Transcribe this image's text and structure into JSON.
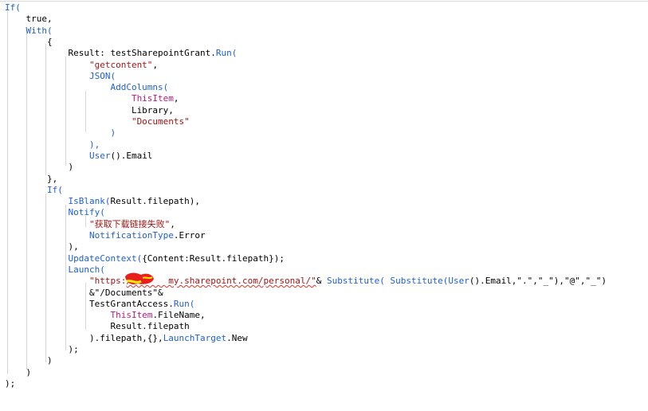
{
  "editor": {
    "lines": [
      [
        {
          "t": "If(",
          "c": "kw"
        }
      ],
      [
        {
          "t": "    true,",
          "c": "pl"
        }
      ],
      [
        {
          "t": "    With(",
          "c": "kw"
        }
      ],
      [
        {
          "t": "        {",
          "c": "pl"
        }
      ],
      [
        {
          "t": "            Result: testSharepointGrant.",
          "c": "pl"
        },
        {
          "t": "Run(",
          "c": "fn"
        }
      ],
      [
        {
          "t": "                \"getcontent\"",
          "c": "str"
        },
        {
          "t": ",",
          "c": "pl"
        }
      ],
      [
        {
          "t": "                JSON(",
          "c": "fn"
        }
      ],
      [
        {
          "t": "                    AddColumns(",
          "c": "fn"
        }
      ],
      [
        {
          "t": "                        ThisItem",
          "c": "id"
        },
        {
          "t": ",",
          "c": "pl"
        }
      ],
      [
        {
          "t": "                        Library,",
          "c": "pl"
        }
      ],
      [
        {
          "t": "                        \"Documents\"",
          "c": "str"
        }
      ],
      [
        {
          "t": "                    )",
          "c": "fn"
        }
      ],
      [
        {
          "t": "                ),",
          "c": "fn"
        }
      ],
      [
        {
          "t": "                User",
          "c": "fn"
        },
        {
          "t": "().Email",
          "c": "pl"
        }
      ],
      [
        {
          "t": "            )",
          "c": "pl"
        }
      ],
      [
        {
          "t": "        },",
          "c": "pl"
        }
      ],
      [
        {
          "t": "        If(",
          "c": "kw"
        }
      ],
      [
        {
          "t": "            IsBlank(",
          "c": "fn"
        },
        {
          "t": "Result.filepath),",
          "c": "pl"
        }
      ],
      [
        {
          "t": "            Notify(",
          "c": "fn"
        }
      ],
      [
        {
          "t": "                \"获取下载链接失败\"",
          "c": "str"
        },
        {
          "t": ",",
          "c": "pl"
        }
      ],
      [
        {
          "t": "                NotificationType",
          "c": "fn"
        },
        {
          "t": ".Error",
          "c": "pl"
        }
      ],
      [
        {
          "t": "            ),",
          "c": "pl"
        }
      ],
      [
        {
          "t": "            UpdateContext(",
          "c": "fn"
        },
        {
          "t": "{Content:Result.filepath});",
          "c": "pl"
        }
      ],
      [
        {
          "t": "            Launch(",
          "c": "fn"
        }
      ],
      [
        {
          "t": "                \"https:",
          "c": "str"
        },
        {
          "t": "//      my.sharepoint.com/personal/\"",
          "c": "str",
          "e": true
        },
        {
          "t": "& ",
          "c": "pl"
        },
        {
          "t": "Substitute( Substitute(",
          "c": "fn"
        },
        {
          "t": "User",
          "c": "fn"
        },
        {
          "t": "().Email,\".\",\"_\"),\"@\",\"_\")",
          "c": "pl"
        }
      ],
      [
        {
          "t": "                &\"/Documents\"&",
          "c": "pl"
        }
      ],
      [
        {
          "t": "                TestGrantAccess.",
          "c": "pl"
        },
        {
          "t": "Run(",
          "c": "fn"
        }
      ],
      [
        {
          "t": "                    ThisItem",
          "c": "id"
        },
        {
          "t": ".FileName,",
          "c": "pl"
        }
      ],
      [
        {
          "t": "                    Result.filepath",
          "c": "pl"
        }
      ],
      [
        {
          "t": "                ).filepath,{},",
          "c": "pl"
        },
        {
          "t": "LaunchTarget",
          "c": "fn"
        },
        {
          "t": ".New",
          "c": "pl"
        }
      ],
      [
        {
          "t": "            );",
          "c": "pl"
        }
      ],
      [
        {
          "t": "        )",
          "c": "pl"
        }
      ],
      [
        {
          "t": "    )",
          "c": "pl"
        }
      ],
      [
        {
          "t": ");",
          "c": "pl"
        }
      ]
    ]
  },
  "colors": {
    "keyword": "#1f5fd6",
    "string": "#a31515",
    "identifier": "#c1177a",
    "text": "#000000",
    "guide": "#d6d6d6",
    "squiggle": "#e0342a",
    "redaction": "#e8201c",
    "highlight": "#ffe500"
  }
}
